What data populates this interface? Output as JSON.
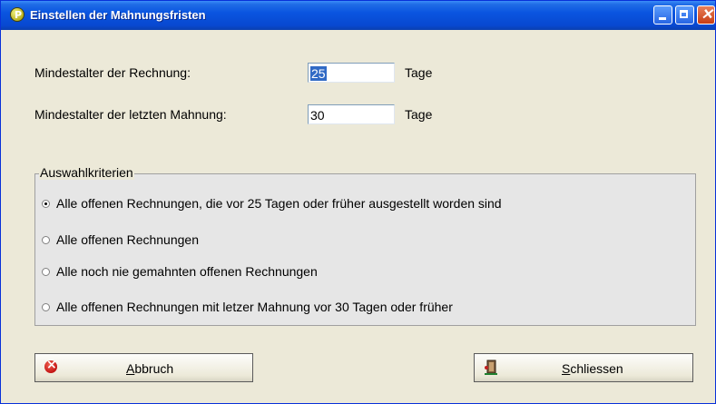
{
  "window": {
    "title": "Einstellen der Mahnungsfristen"
  },
  "fields": {
    "min_age_invoice_label": "Mindestalter der Rechnung:",
    "min_age_invoice_value": "25",
    "min_age_invoice_unit": "Tage",
    "min_age_reminder_label": "Mindestalter der letzten Mahnung:",
    "min_age_reminder_value": "30",
    "min_age_reminder_unit": "Tage"
  },
  "criteria": {
    "title": "Auswahlkriterien",
    "options": [
      {
        "label": "Alle offenen Rechnungen, die vor 25 Tagen oder früher ausgestellt worden sind",
        "selected": true
      },
      {
        "label": "Alle offenen Rechnungen",
        "selected": false
      },
      {
        "label": "Alle noch nie gemahnten offenen Rechnungen",
        "selected": false
      },
      {
        "label": "Alle offenen Rechnungen mit letzer Mahnung vor 30 Tagen oder früher",
        "selected": false
      }
    ]
  },
  "buttons": {
    "cancel_mnemonic": "A",
    "cancel_rest": "bbruch",
    "close_mnemonic": "S",
    "close_rest": "chliessen"
  },
  "icons": {
    "app": "p-app-icon",
    "cancel": "red-x-circle-icon",
    "close": "exit-door-icon"
  },
  "colors": {
    "titlebar": "#0a55e0",
    "dialog_bg": "#ece9d8",
    "selection": "#316ac5"
  }
}
